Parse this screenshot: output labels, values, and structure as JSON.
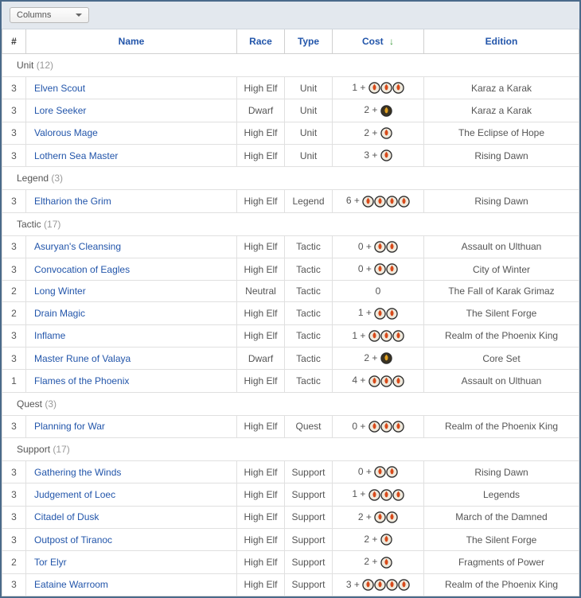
{
  "toolbar": {
    "columns_label": "Columns"
  },
  "headers": {
    "qty": "#",
    "name": "Name",
    "race": "Race",
    "type": "Type",
    "cost": "Cost",
    "edition": "Edition",
    "sort_indicator": "↓"
  },
  "icons": {
    "flame": {
      "fg": "#d84a1a",
      "ring": "#2b2b2b",
      "fill": "#efe9dc"
    },
    "dwarf": {
      "fg": "#e0a020",
      "ring": "#2b2b2b",
      "fill": "#3b3322"
    }
  },
  "groups": [
    {
      "label": "Unit",
      "count": 12,
      "rows": [
        {
          "qty": 3,
          "name": "Elven Scout",
          "race": "High Elf",
          "type": "Unit",
          "cost_num": "1 +",
          "cost_icons": [
            "flame",
            "flame",
            "flame"
          ],
          "edition": "Karaz a Karak"
        },
        {
          "qty": 3,
          "name": "Lore Seeker",
          "race": "Dwarf",
          "type": "Unit",
          "cost_num": "2 +",
          "cost_icons": [
            "dwarf"
          ],
          "edition": "Karaz a Karak"
        },
        {
          "qty": 3,
          "name": "Valorous Mage",
          "race": "High Elf",
          "type": "Unit",
          "cost_num": "2 +",
          "cost_icons": [
            "flame"
          ],
          "edition": "The Eclipse of Hope"
        },
        {
          "qty": 3,
          "name": "Lothern Sea Master",
          "race": "High Elf",
          "type": "Unit",
          "cost_num": "3 +",
          "cost_icons": [
            "flame"
          ],
          "edition": "Rising Dawn"
        }
      ]
    },
    {
      "label": "Legend",
      "count": 3,
      "rows": [
        {
          "qty": 3,
          "name": "Eltharion the Grim",
          "race": "High Elf",
          "type": "Legend",
          "cost_num": "6 +",
          "cost_icons": [
            "flame",
            "flame",
            "flame",
            "flame"
          ],
          "edition": "Rising Dawn"
        }
      ]
    },
    {
      "label": "Tactic",
      "count": 17,
      "rows": [
        {
          "qty": 3,
          "name": "Asuryan's Cleansing",
          "race": "High Elf",
          "type": "Tactic",
          "cost_num": "0 +",
          "cost_icons": [
            "flame",
            "flame"
          ],
          "edition": "Assault on Ulthuan"
        },
        {
          "qty": 3,
          "name": "Convocation of Eagles",
          "race": "High Elf",
          "type": "Tactic",
          "cost_num": "0 +",
          "cost_icons": [
            "flame",
            "flame"
          ],
          "edition": "City of Winter"
        },
        {
          "qty": 2,
          "name": "Long Winter",
          "race": "Neutral",
          "type": "Tactic",
          "cost_num": "0",
          "cost_icons": [],
          "edition": "The Fall of Karak Grimaz"
        },
        {
          "qty": 2,
          "name": "Drain Magic",
          "race": "High Elf",
          "type": "Tactic",
          "cost_num": "1 +",
          "cost_icons": [
            "flame",
            "flame"
          ],
          "edition": "The Silent Forge"
        },
        {
          "qty": 3,
          "name": "Inflame",
          "race": "High Elf",
          "type": "Tactic",
          "cost_num": "1 +",
          "cost_icons": [
            "flame",
            "flame",
            "flame"
          ],
          "edition": "Realm of the Phoenix King"
        },
        {
          "qty": 3,
          "name": "Master Rune of Valaya",
          "race": "Dwarf",
          "type": "Tactic",
          "cost_num": "2 +",
          "cost_icons": [
            "dwarf"
          ],
          "edition": "Core Set"
        },
        {
          "qty": 1,
          "name": "Flames of the Phoenix",
          "race": "High Elf",
          "type": "Tactic",
          "cost_num": "4 +",
          "cost_icons": [
            "flame",
            "flame",
            "flame"
          ],
          "edition": "Assault on Ulthuan"
        }
      ]
    },
    {
      "label": "Quest",
      "count": 3,
      "rows": [
        {
          "qty": 3,
          "name": "Planning for War",
          "race": "High Elf",
          "type": "Quest",
          "cost_num": "0 +",
          "cost_icons": [
            "flame",
            "flame",
            "flame"
          ],
          "edition": "Realm of the Phoenix King"
        }
      ]
    },
    {
      "label": "Support",
      "count": 17,
      "rows": [
        {
          "qty": 3,
          "name": "Gathering the Winds",
          "race": "High Elf",
          "type": "Support",
          "cost_num": "0 +",
          "cost_icons": [
            "flame",
            "flame"
          ],
          "edition": "Rising Dawn"
        },
        {
          "qty": 3,
          "name": "Judgement of Loec",
          "race": "High Elf",
          "type": "Support",
          "cost_num": "1 +",
          "cost_icons": [
            "flame",
            "flame",
            "flame"
          ],
          "edition": "Legends"
        },
        {
          "qty": 3,
          "name": "Citadel of Dusk",
          "race": "High Elf",
          "type": "Support",
          "cost_num": "2 +",
          "cost_icons": [
            "flame",
            "flame"
          ],
          "edition": "March of the Damned"
        },
        {
          "qty": 3,
          "name": "Outpost of Tiranoc",
          "race": "High Elf",
          "type": "Support",
          "cost_num": "2 +",
          "cost_icons": [
            "flame"
          ],
          "edition": "The Silent Forge"
        },
        {
          "qty": 2,
          "name": "Tor Elyr",
          "race": "High Elf",
          "type": "Support",
          "cost_num": "2 +",
          "cost_icons": [
            "flame"
          ],
          "edition": "Fragments of Power"
        },
        {
          "qty": 3,
          "name": "Eataine Warroom",
          "race": "High Elf",
          "type": "Support",
          "cost_num": "3 +",
          "cost_icons": [
            "flame",
            "flame",
            "flame",
            "flame"
          ],
          "edition": "Realm of the Phoenix King"
        }
      ]
    }
  ]
}
